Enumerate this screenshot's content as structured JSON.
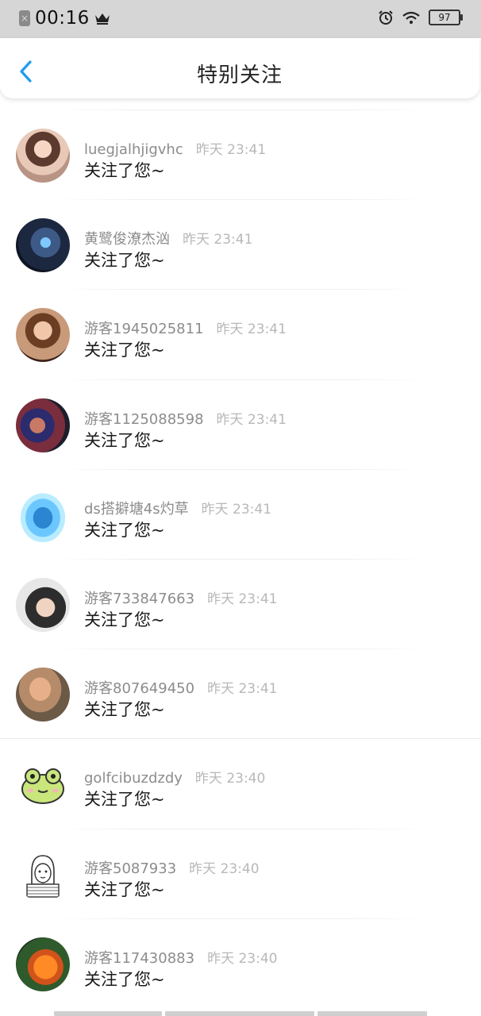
{
  "status_bar": {
    "time": "00:16",
    "battery": "97",
    "notification_icon": "close-square-icon",
    "crown_icon": "crown-icon",
    "alarm_icon": "alarm-icon",
    "wifi_icon": "wifi-icon"
  },
  "header": {
    "title": "特别关注",
    "back_icon": "chevron-left-icon",
    "accent": "#1e9bf0"
  },
  "follows": [
    {
      "name": "luegjalhjigvhc",
      "time": "昨天 23:41",
      "message": "关注了您~"
    },
    {
      "name": "黄鹭俊潦杰汹",
      "time": "昨天 23:41",
      "message": "关注了您~"
    },
    {
      "name": "游客1945025811",
      "time": "昨天 23:41",
      "message": "关注了您~"
    },
    {
      "name": "游客1125088598",
      "time": "昨天 23:41",
      "message": "关注了您~"
    },
    {
      "name": "ds搭擗塘4s灼草",
      "time": "昨天 23:41",
      "message": "关注了您~"
    },
    {
      "name": "游客733847663",
      "time": "昨天 23:41",
      "message": "关注了您~"
    },
    {
      "name": "游客807649450",
      "time": "昨天 23:41",
      "message": "关注了您~"
    },
    {
      "name": "golfcibuzdzdy",
      "time": "昨天 23:40",
      "message": "关注了您~"
    },
    {
      "name": "游客5087933",
      "time": "昨天 23:40",
      "message": "关注了您~"
    },
    {
      "name": "游客117430883",
      "time": "昨天 23:40",
      "message": "关注了您~"
    }
  ]
}
